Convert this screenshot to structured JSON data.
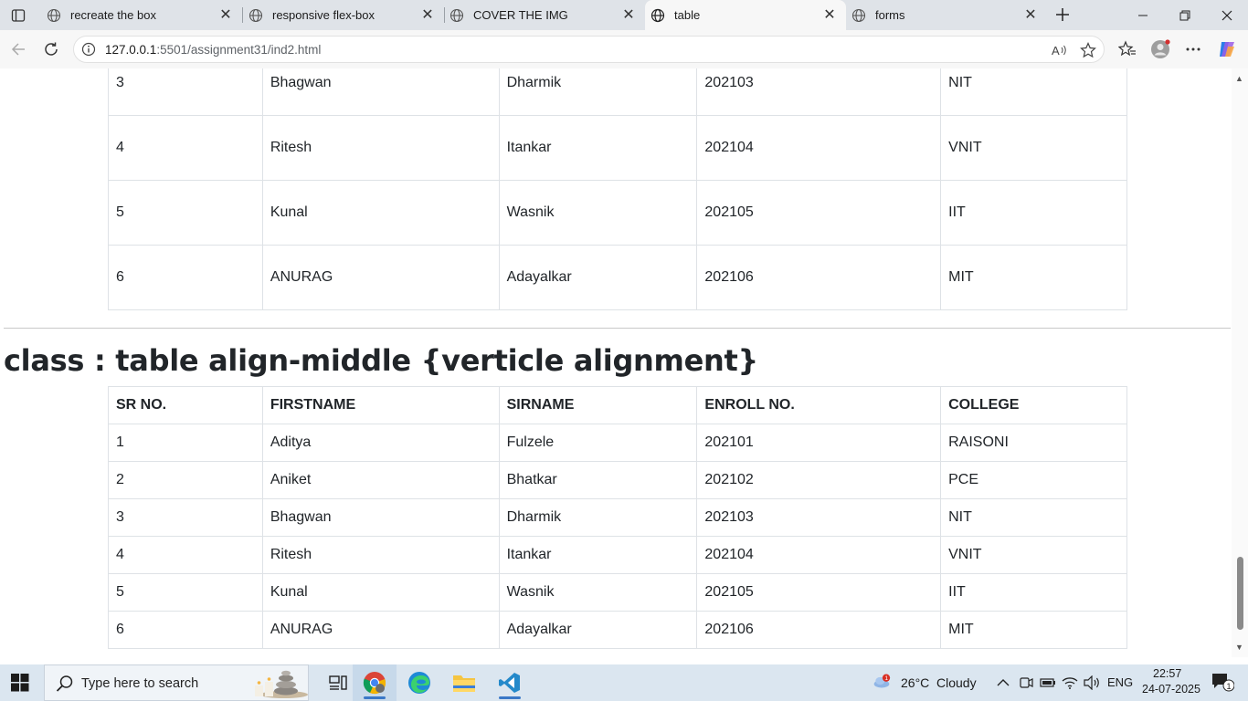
{
  "browser": {
    "tabs": [
      {
        "title": "recreate the box",
        "active": false
      },
      {
        "title": "responsive flex-box",
        "active": false
      },
      {
        "title": "COVER THE IMG",
        "active": false
      },
      {
        "title": "table",
        "active": true
      },
      {
        "title": "forms",
        "active": false
      }
    ],
    "url_host": "127.0.0.1",
    "url_rest": ":5501/assignment31/ind2.html"
  },
  "page": {
    "table1_rows": [
      [
        "3",
        "Bhagwan",
        "Dharmik",
        "202103",
        "NIT"
      ],
      [
        "4",
        "Ritesh",
        "Itankar",
        "202104",
        "VNIT"
      ],
      [
        "5",
        "Kunal",
        "Wasnik",
        "202105",
        "IIT"
      ],
      [
        "6",
        "ANURAG",
        "Adayalkar",
        "202106",
        "MIT"
      ]
    ],
    "heading": "class : table align-middle {verticle alignment}",
    "table2": {
      "headers": [
        "SR NO.",
        "FIRSTNAME",
        "SIRNAME",
        "ENROLL NO.",
        "COLLEGE"
      ],
      "rows": [
        [
          "1",
          "Aditya",
          "Fulzele",
          "202101",
          "RAISONI"
        ],
        [
          "2",
          "Aniket",
          "Bhatkar",
          "202102",
          "PCE"
        ],
        [
          "3",
          "Bhagwan",
          "Dharmik",
          "202103",
          "NIT"
        ],
        [
          "4",
          "Ritesh",
          "Itankar",
          "202104",
          "VNIT"
        ],
        [
          "5",
          "Kunal",
          "Wasnik",
          "202105",
          "IIT"
        ],
        [
          "6",
          "ANURAG",
          "Adayalkar",
          "202106",
          "MIT"
        ]
      ]
    }
  },
  "taskbar": {
    "search_placeholder": "Type here to search",
    "weather_temp": "26°C",
    "weather_text": "Cloudy",
    "weather_badge": "1",
    "language": "ENG",
    "time": "22:57",
    "date": "24-07-2025",
    "notification_count": "1"
  },
  "colors": {
    "tabbar_bg": "#dfe3e8",
    "taskbar_bg": "#dbe6f0",
    "table_border": "#dee2e6",
    "text": "#212529"
  }
}
